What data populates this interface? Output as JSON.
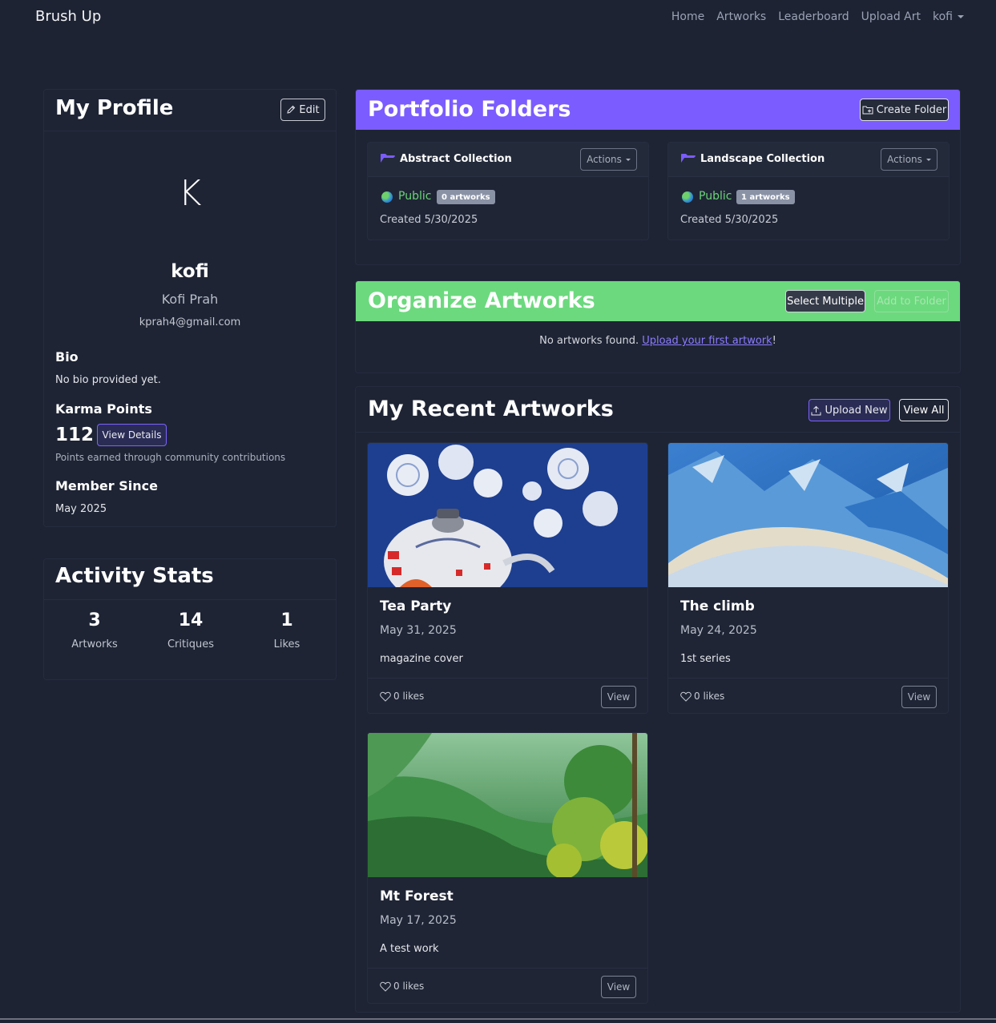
{
  "navbar": {
    "brand": "Brush Up",
    "links": [
      "Home",
      "Artworks",
      "Leaderboard",
      "Upload Art"
    ],
    "user": "kofi"
  },
  "profile": {
    "title": "My Profile",
    "edit_label": "Edit",
    "avatar_letter": "K",
    "username": "kofi",
    "full_name": "Kofi Prah",
    "email": "kprah4@gmail.com",
    "bio_label": "Bio",
    "bio_text": "No bio provided yet.",
    "karma_label": "Karma Points",
    "karma_value": "112",
    "view_details_label": "View Details",
    "karma_note": "Points earned through community contributions",
    "member_label": "Member Since",
    "member_value": "May 2025"
  },
  "activity": {
    "title": "Activity Stats",
    "stats": [
      {
        "value": "3",
        "label": "Artworks"
      },
      {
        "value": "14",
        "label": "Critiques"
      },
      {
        "value": "1",
        "label": "Likes"
      }
    ]
  },
  "folders": {
    "title": "Portfolio Folders",
    "band_color": "#7b5cff",
    "create_label": "Create Folder",
    "items": [
      {
        "name": "Abstract Collection",
        "actions_label": "Actions",
        "visibility": "Public",
        "count": "0 artworks",
        "created": "Created 5/30/2025"
      },
      {
        "name": "Landscape Collection",
        "actions_label": "Actions",
        "visibility": "Public",
        "count": "1 artworks",
        "created": "Created 5/30/2025"
      }
    ]
  },
  "organize": {
    "title": "Organize Artworks",
    "band_color": "#6cd97e",
    "select_multiple_label": "Select Multiple",
    "add_to_folder_label": "Add to Folder",
    "empty_text": "No artworks found. ",
    "empty_link": "Upload your first artwork",
    "empty_suffix": "!"
  },
  "recent": {
    "title": "My Recent Artworks",
    "upload_new_label": "Upload New",
    "view_all_label": "View All",
    "artworks": [
      {
        "title": "Tea Party",
        "date": "May 31, 2025",
        "description": "magazine cover",
        "likes": "0 likes",
        "view_label": "View"
      },
      {
        "title": "The climb",
        "date": "May 24, 2025",
        "description": "1st series",
        "likes": "0 likes",
        "view_label": "View"
      },
      {
        "title": "Mt Forest",
        "date": "May 17, 2025",
        "description": "A test work",
        "likes": "0 likes",
        "view_label": "View"
      }
    ]
  }
}
